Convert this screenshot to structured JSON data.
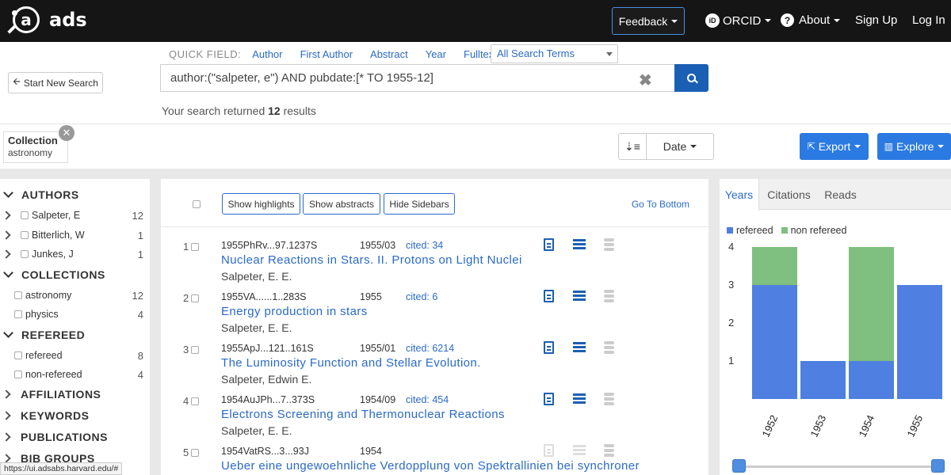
{
  "header": {
    "logo_letter": "a",
    "logo_text": "ads",
    "feedback": "Feedback",
    "orcid": "ORCID",
    "about": "About",
    "sign_up": "Sign Up",
    "log_in": "Log In"
  },
  "quick_field": {
    "label": "QUICK FIELD:",
    "links": [
      "Author",
      "First Author",
      "Abstract",
      "Year",
      "Fulltext"
    ],
    "select_value": "All Search Terms"
  },
  "search": {
    "start_new": "Start New Search",
    "query": "author:(\"salpeter, e\") AND pubdate:[* TO 1955-12]",
    "result_prefix": "Your search returned",
    "result_count": "12",
    "result_suffix": "results"
  },
  "filter_chip": {
    "title": "Collection",
    "value": "astronomy"
  },
  "sort": {
    "label": "Date"
  },
  "actions": {
    "export": "Export",
    "explore": "Explore"
  },
  "facets": {
    "authors": {
      "label": "AUTHORS",
      "items": [
        {
          "name": "Salpeter, E",
          "count": "12"
        },
        {
          "name": "Bitterlich, W",
          "count": "1"
        },
        {
          "name": "Junkes, J",
          "count": "1"
        }
      ]
    },
    "collections": {
      "label": "COLLECTIONS",
      "items": [
        {
          "name": "astronomy",
          "count": "12"
        },
        {
          "name": "physics",
          "count": "4"
        }
      ]
    },
    "refereed": {
      "label": "REFEREED",
      "items": [
        {
          "name": "refereed",
          "count": "8"
        },
        {
          "name": "non-refereed",
          "count": "4"
        }
      ]
    },
    "affiliations": "AFFILIATIONS",
    "keywords": "KEYWORDS",
    "publications": "PUBLICATIONS",
    "bibgroups": "BIB GROUPS"
  },
  "toolbar": {
    "show_highlights": "Show highlights",
    "show_abstracts": "Show abstracts",
    "hide_sidebars": "Hide Sidebars",
    "go_to_bottom": "Go To Bottom"
  },
  "results": [
    {
      "num": "1",
      "bibcode": "1955PhRv...97.1237S",
      "date": "1955/03",
      "cited": "cited: 34",
      "title": "Nuclear Reactions in Stars. II. Protons on Light Nuclei",
      "authors": "Salpeter, E. E."
    },
    {
      "num": "2",
      "bibcode": "1955VA......1..283S",
      "date": "1955",
      "cited": "cited: 6",
      "title": "Energy production in stars",
      "authors": "Salpeter, E. E."
    },
    {
      "num": "3",
      "bibcode": "1955ApJ...121..161S",
      "date": "1955/01",
      "cited": "cited: 6214",
      "title": "The Luminosity Function and Stellar Evolution.",
      "authors": "Salpeter, Edwin E."
    },
    {
      "num": "4",
      "bibcode": "1954AuJPh...7..373S",
      "date": "1954/09",
      "cited": "cited: 454",
      "title": "Electrons Screening and Thermonuclear Reactions",
      "authors": "Salpeter, E. E."
    },
    {
      "num": "5",
      "bibcode": "1954VatRS...3...93J",
      "date": "1954",
      "cited": "",
      "title": "Ueber eine ungewoehnliche Verdopplung von Spektrallinien bei synchroner",
      "authors": ""
    }
  ],
  "right_panel": {
    "tabs": [
      "Years",
      "Citations",
      "Reads"
    ],
    "legend": [
      "refereed",
      "non refereed"
    ]
  },
  "colors": {
    "refereed": "#4f7fe0",
    "non_refereed": "#7fbf7f",
    "brand_blue": "#1a5fb4"
  },
  "chart_data": {
    "type": "bar",
    "stacked": true,
    "categories": [
      "1952",
      "1953",
      "1954",
      "1955"
    ],
    "series": [
      {
        "name": "refereed",
        "values": [
          3,
          1,
          1,
          3
        ]
      },
      {
        "name": "non refereed",
        "values": [
          1,
          0,
          3,
          0
        ]
      }
    ],
    "ylim": [
      0,
      4
    ],
    "yticks": [
      "1",
      "2",
      "3",
      "4"
    ]
  },
  "status_url": "https://ui.adsabs.harvard.edu/#"
}
